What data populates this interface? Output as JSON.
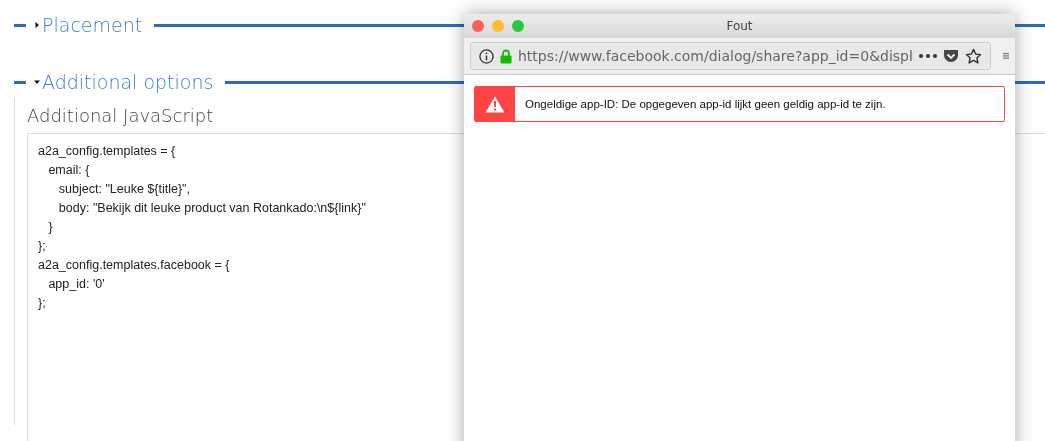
{
  "sections": [
    {
      "title": "Placement",
      "expanded": false
    },
    {
      "title": "Additional options",
      "expanded": true,
      "field_label": "Additional JavaScript",
      "code": "a2a_config.templates = {\n   email: {\n      subject: \"Leuke ${title}\",\n      body: \"Bekijk dit leuke product van Rotankado:\\n${link}\"\n   }\n};\na2a_config.templates.facebook = {\n   app_id: '0'\n};"
    }
  ],
  "popup": {
    "title": "Fout",
    "url": "https://www.facebook.com/dialog/share?app_id=0&displ",
    "error": "Ongeldige app-ID: De opgegeven app-id lijkt geen geldig app-id te zijn."
  }
}
